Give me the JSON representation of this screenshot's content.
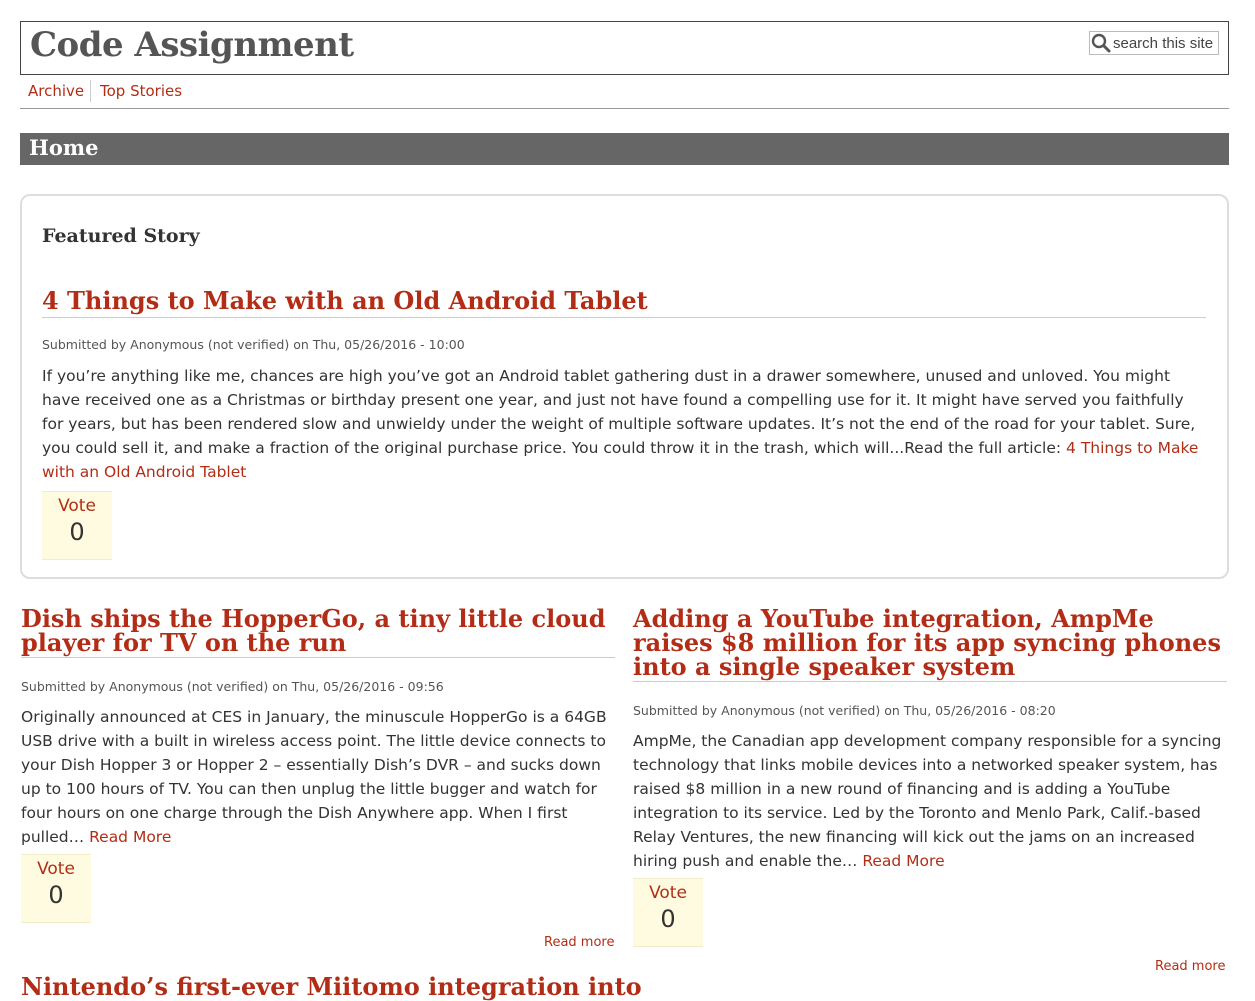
{
  "site": {
    "title": "Code Assignment",
    "search_placeholder": "search this site"
  },
  "nav": {
    "items": [
      {
        "label": "Archive"
      },
      {
        "label": "Top Stories"
      }
    ]
  },
  "page": {
    "title": "Home"
  },
  "featured": {
    "section_label": "Featured Story",
    "title": "4 Things to Make with an Old Android Tablet",
    "meta": "Submitted by Anonymous (not verified) on Thu, 05/26/2016 - 10:00",
    "body": "If you’re anything like me, chances are high you’ve got an Android tablet gathering dust in a drawer somewhere, unused and unloved. You might have received one as a Christmas or birthday present one year, and just not have found a compelling use for it. It might have served you faithfully for years, but has been rendered slow and unwieldy under the weight of multiple software updates. It’s not the end of the road for your tablet. Sure, you could sell it, and make a fraction of the original purchase price. You could throw it in the trash, which will...Read the full article: ",
    "link_label": "4 Things to Make with an Old Android Tablet",
    "vote_label": "Vote",
    "vote_count": "0"
  },
  "stories": [
    {
      "title": "Dish ships the HopperGo, a tiny little cloud player for TV on the run",
      "meta": "Submitted by Anonymous (not verified) on Thu, 05/26/2016 - 09:56",
      "body": " Originally announced at CES in January, the minuscule HopperGo is a 64GB USB drive with a built in wireless access point. The little device connects to your Dish Hopper 3 or Hopper 2 – essentially Dish’s DVR – and sucks down up to 100 hours of TV. You can then unplug the little bugger and watch for four hours on one charge through the Dish Anywhere app. When I first pulled… ",
      "inline_link": "Read More",
      "vote_label": "Vote",
      "vote_count": "0",
      "read_more": "Read more"
    },
    {
      "title": "Adding a YouTube integration, AmpMe raises $8 million for its app syncing phones into a single speaker system",
      "meta": "Submitted by Anonymous (not verified) on Thu, 05/26/2016 - 08:20",
      "body": " AmpMe, the Canadian app development company responsible for a syncing technology that links mobile devices into a networked speaker system, has raised $8 million in a new round of financing and is adding a YouTube integration to its service. Led by the Toronto and Menlo Park, Calif.-based Relay Ventures, the new financing will kick out the jams on an increased hiring push and enable the… ",
      "inline_link": "Read More",
      "vote_label": "Vote",
      "vote_count": "0",
      "read_more": "Read more"
    }
  ],
  "next_story": {
    "title": "Nintendo’s first-ever Miitomo integration into"
  },
  "colors": {
    "link": "#b32d16",
    "home_bar": "#666666",
    "vote_bg": "#fffbe0"
  }
}
